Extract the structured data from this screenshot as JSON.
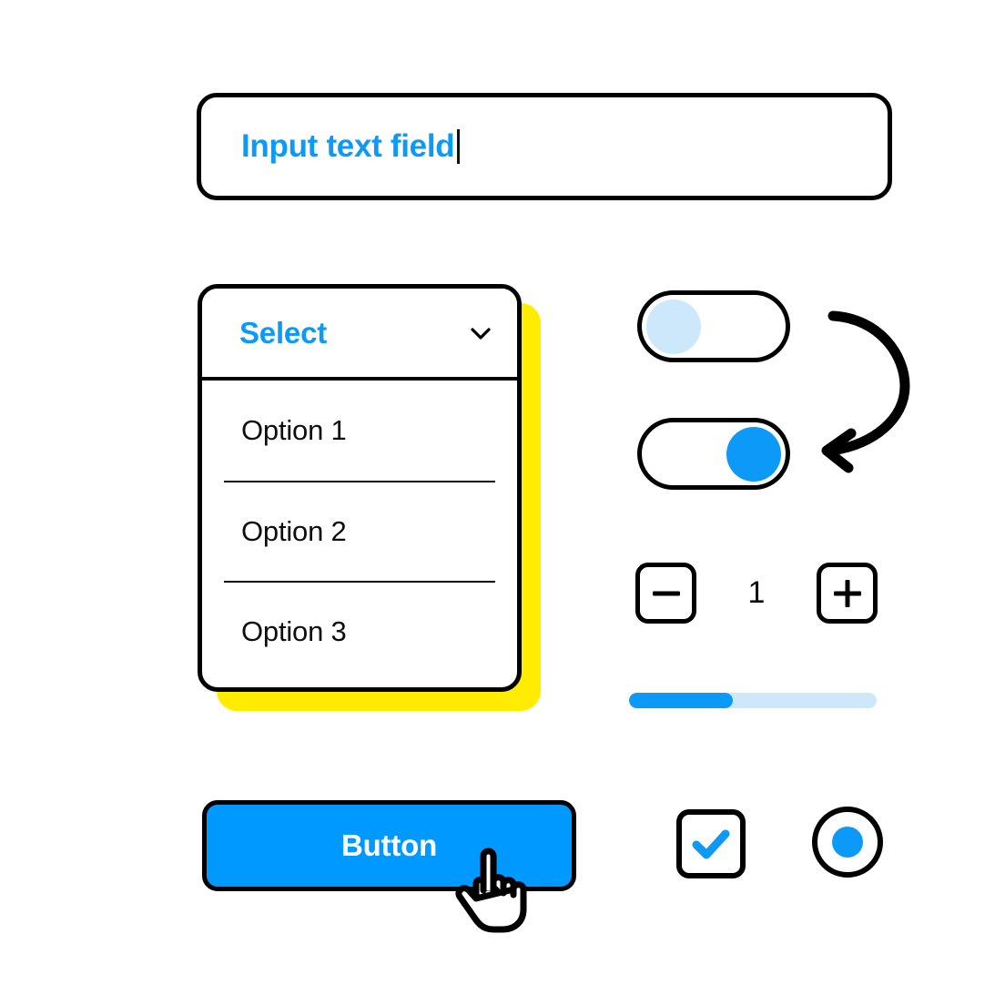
{
  "palette": {
    "accent_blue": "#0D99F7",
    "button_blue": "#0099FF",
    "light_blue": "#CEE8FB",
    "yellow_shadow": "#FFEC00",
    "outline_black": "#000000",
    "text_black": "#0D0D0D",
    "white": "#FFFFFF"
  },
  "input_field": {
    "value": "Input text field",
    "placeholder": "Input text field",
    "caret_visible": true
  },
  "select": {
    "label": "Select",
    "chevron_icon": "chevron-down-icon",
    "expanded": true,
    "options": [
      {
        "label": "Option 1"
      },
      {
        "label": "Option 2"
      },
      {
        "label": "Option 3"
      }
    ]
  },
  "toggles": {
    "arrow_icon": "curved-arrow-down-icon",
    "items": [
      {
        "name": "toggle-off",
        "state": "off",
        "knob_color": "#CEE8FB"
      },
      {
        "name": "toggle-on",
        "state": "on",
        "knob_color": "#0D99F7"
      }
    ]
  },
  "stepper": {
    "decrement_icon": "minus-icon",
    "increment_icon": "plus-icon",
    "value": "1"
  },
  "progress": {
    "percent": 42,
    "fill_width": "42%"
  },
  "button": {
    "label": "Button",
    "cursor_icon": "hand-pointer-cursor-icon"
  },
  "checkbox": {
    "checked": true,
    "icon": "check-icon"
  },
  "radio": {
    "selected": true,
    "icon": "radio-dot-icon"
  }
}
